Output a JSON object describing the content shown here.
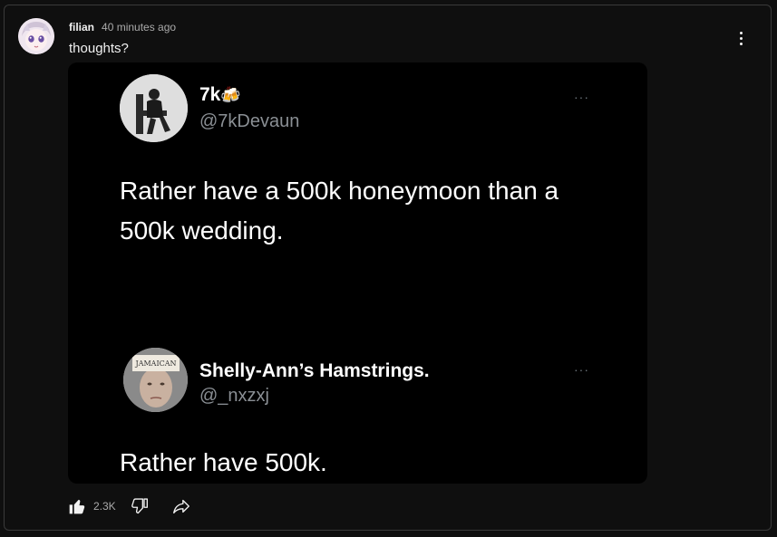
{
  "comment": {
    "author": "filian",
    "timestamp": "40 minutes ago",
    "text": "thoughts?",
    "likes": "2.3K"
  },
  "attached_image": {
    "tweets": [
      {
        "name": "7k",
        "emoji": "🍻",
        "handle": "@7kDevaun",
        "more": "···",
        "text": "Rather have a 500k honeymoon than a 500k wedding."
      },
      {
        "name": "Shelly-Ann’s Hamstrings.",
        "handle": "@_nxzxj",
        "more": "···",
        "text": "Rather have 500k.",
        "avatar_sign": "JAMAICAN"
      }
    ]
  },
  "icons": [
    "more-vert-icon",
    "like-icon",
    "dislike-icon",
    "share-icon"
  ]
}
